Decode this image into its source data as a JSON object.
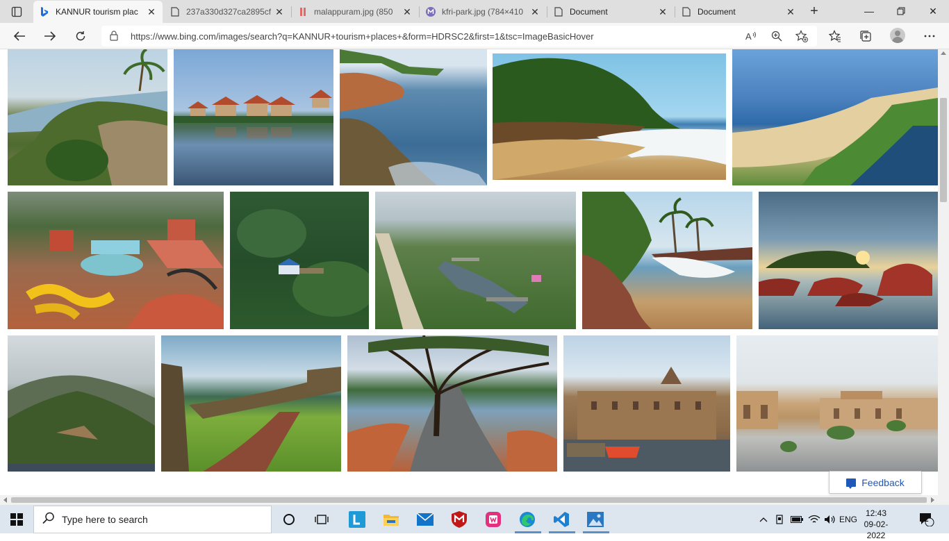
{
  "tabs": [
    {
      "title": "KANNUR tourism plac",
      "favicon": "bing-icon",
      "active": true
    },
    {
      "title": "237a330d327ca2895cf",
      "favicon": "document-icon",
      "active": false
    },
    {
      "title": "malappuram.jpg (850",
      "favicon": "image-file-icon",
      "active": false
    },
    {
      "title": "kfri-park.jpg (784×410",
      "favicon": "image-viewer-icon",
      "active": false
    },
    {
      "title": "Document",
      "favicon": "document-icon",
      "active": false
    },
    {
      "title": "Document",
      "favicon": "document-icon",
      "active": false
    }
  ],
  "address_bar": {
    "url": "https://www.bing.com/images/search?q=KANNUR+tourism+places+&form=HDRSC2&first=1&tsc=ImageBasicHover"
  },
  "feedback": {
    "label": "Feedback"
  },
  "taskbar": {
    "search_placeholder": "Type here to search",
    "apps": [
      "task-view-icon",
      "lively-icon",
      "file-explorer-icon",
      "mail-icon",
      "mcafee-icon",
      "office-icon",
      "edge-icon",
      "vscode-icon",
      "photos-icon"
    ],
    "language": "ENG",
    "time": "12:43",
    "date": "09-02-2022",
    "notifications": "2"
  },
  "results": [
    {
      "name": "coastal-cliff-palm"
    },
    {
      "name": "lakeside-resort-cottages"
    },
    {
      "name": "rocky-shore-fort"
    },
    {
      "name": "palm-beach-waves"
    },
    {
      "name": "long-beach-aerial"
    },
    {
      "name": "water-park-aerial"
    },
    {
      "name": "forest-hill-temple"
    },
    {
      "name": "river-estuary-bridge"
    },
    {
      "name": "red-cliff-beach-palms"
    },
    {
      "name": "sunset-rocks-island"
    },
    {
      "name": "misty-hill-view"
    },
    {
      "name": "green-fort-walls"
    },
    {
      "name": "roadside-tree-river"
    },
    {
      "name": "riverside-palace-boats"
    },
    {
      "name": "courtyard-palace"
    }
  ],
  "colors": {
    "bing_blue": "#1e6fd6",
    "link_blue": "#1f58b8",
    "taskbar": "#dde6ef"
  }
}
